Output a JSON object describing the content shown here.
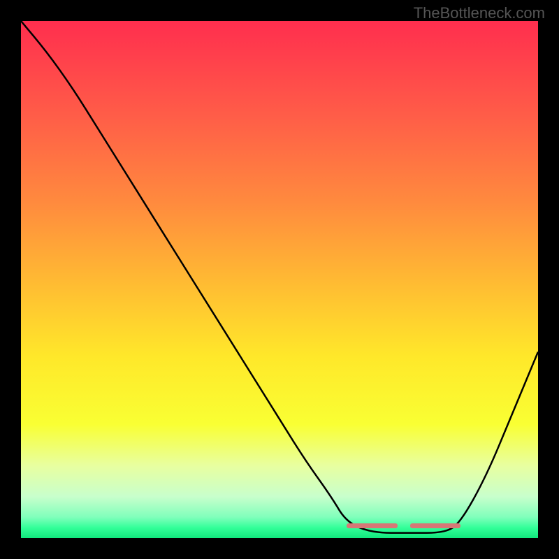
{
  "watermark": "TheBottleneck.com",
  "chart_data": {
    "type": "line",
    "title": "",
    "xlabel": "",
    "ylabel": "",
    "xlim": [
      0,
      100
    ],
    "ylim": [
      0,
      100
    ],
    "description": "Bottleneck curve showing performance valley with rainbow gradient background (red=high bottleneck, green=low bottleneck)",
    "series": [
      {
        "name": "bottleneck-curve",
        "x": [
          0,
          5,
          10,
          15,
          20,
          25,
          30,
          35,
          40,
          45,
          50,
          55,
          60,
          63,
          68,
          75,
          82,
          85,
          90,
          95,
          100
        ],
        "y": [
          100,
          94,
          87,
          79,
          71,
          63,
          55,
          47,
          39,
          31,
          23,
          15,
          8,
          3,
          1,
          1,
          1,
          3,
          12,
          24,
          36
        ]
      }
    ],
    "optimal_range": {
      "start_x": 63,
      "end_x": 85
    },
    "gradient_stops": [
      {
        "offset": 0,
        "color": "#ff2e4e"
      },
      {
        "offset": 18,
        "color": "#ff5c48"
      },
      {
        "offset": 35,
        "color": "#ff8a3e"
      },
      {
        "offset": 50,
        "color": "#ffb933"
      },
      {
        "offset": 65,
        "color": "#ffe82a"
      },
      {
        "offset": 78,
        "color": "#f9ff33"
      },
      {
        "offset": 86,
        "color": "#e8ffa0"
      },
      {
        "offset": 92,
        "color": "#c8ffcc"
      },
      {
        "offset": 96,
        "color": "#7fffbb"
      },
      {
        "offset": 98,
        "color": "#33ff99"
      },
      {
        "offset": 100,
        "color": "#11e87d"
      }
    ]
  }
}
